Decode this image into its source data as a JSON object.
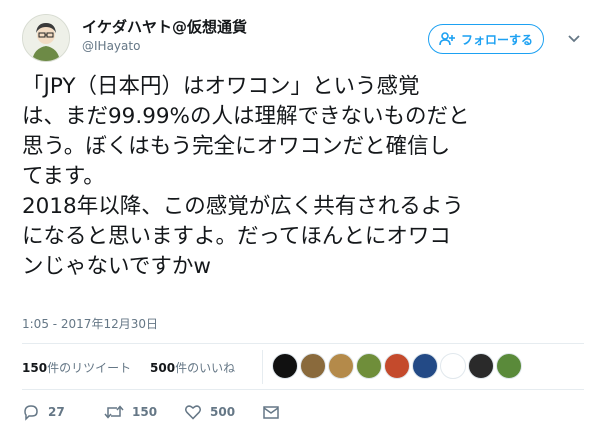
{
  "user": {
    "display_name": "イケダハヤト@仮想通貨",
    "handle": "@IHayato",
    "follow_label": "フォローする"
  },
  "tweet": {
    "text": "「JPY（日本円）はオワコン」という感覚\nは、まだ99.99%の人は理解できないものだと\n思う。ぼくはもう完全にオワコンだと確信し\nてます。\n2018年以降、この感覚が広く共有されるよう\nになると思いますよ。だってほんとにオワコ\nンじゃないですかw",
    "timestamp": "1:05 - 2017年12月30日"
  },
  "stats": {
    "retweets_count": "150",
    "retweets_label": "件のリツイート",
    "likes_count": "500",
    "likes_label": "件のいいね"
  },
  "likers": [
    {
      "name": "liker-avatar-1",
      "color": "#111111"
    },
    {
      "name": "liker-avatar-2",
      "color": "#8a6a3c"
    },
    {
      "name": "liker-avatar-3",
      "color": "#b48a4a"
    },
    {
      "name": "liker-avatar-4",
      "color": "#6f8e3a"
    },
    {
      "name": "liker-avatar-5",
      "color": "#c44a2c"
    },
    {
      "name": "liker-avatar-6",
      "color": "#234a86"
    },
    {
      "name": "liker-avatar-7",
      "color": "#ffffff"
    },
    {
      "name": "liker-avatar-8",
      "color": "#2a2a2a"
    },
    {
      "name": "liker-avatar-9",
      "color": "#5a8a3a"
    }
  ],
  "actions": {
    "reply_count": "27",
    "retweet_count": "150",
    "like_count": "500"
  },
  "colors": {
    "accent": "#1da1f2",
    "secondary_text": "#657786",
    "divider": "#e6ecf0"
  },
  "icons": {
    "follow": "add-user-icon",
    "caret": "chevron-down-icon",
    "reply": "reply-icon",
    "retweet": "retweet-icon",
    "like": "heart-icon",
    "message": "envelope-icon"
  }
}
